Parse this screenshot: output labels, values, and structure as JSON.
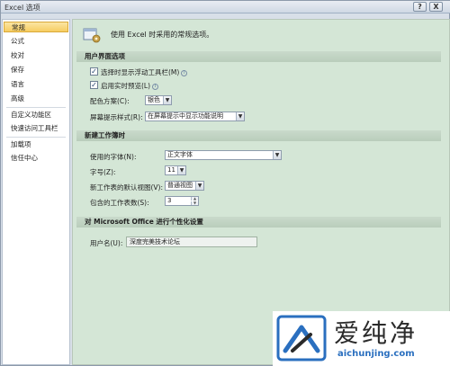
{
  "window": {
    "title": "Excel 选项",
    "help_label": "?",
    "close_label": "X"
  },
  "nav": {
    "items": [
      {
        "label": "常规",
        "selected": true
      },
      {
        "label": "公式"
      },
      {
        "label": "校对"
      },
      {
        "label": "保存"
      },
      {
        "label": "语言"
      },
      {
        "label": "高级"
      },
      {
        "label": "自定义功能区"
      },
      {
        "label": "快速访问工具栏"
      },
      {
        "label": "加载项"
      },
      {
        "label": "信任中心"
      }
    ]
  },
  "header": {
    "text": "使用 Excel 时采用的常规选项。",
    "icon": "gear-icon"
  },
  "ui_options": {
    "title": "用户界面选项",
    "show_mini_toolbar": {
      "label": "选择时显示浮动工具栏(M)",
      "checked": true
    },
    "live_preview": {
      "label": "启用实时预览(L)",
      "checked": true
    },
    "color_scheme": {
      "label": "配色方案(C):",
      "value": "银色"
    },
    "screentip_style": {
      "label": "屏幕提示样式(R):",
      "value": "在屏幕提示中显示功能说明"
    }
  },
  "new_workbook": {
    "title": "新建工作簿时",
    "font": {
      "label": "使用的字体(N):",
      "value": "正文字体"
    },
    "font_size": {
      "label": "字号(Z):",
      "value": "11"
    },
    "default_view": {
      "label": "新工作表的默认视图(V):",
      "value": "普通视图"
    },
    "sheet_count": {
      "label": "包含的工作表数(S):",
      "value": "3"
    }
  },
  "personalize": {
    "title": "对 Microsoft Office 进行个性化设置",
    "username": {
      "label": "用户名(U):",
      "value": "深度完美技术论坛"
    }
  },
  "watermark": {
    "title": "爱纯净",
    "url": "aichunjing.com"
  },
  "colors": {
    "content_bg": "#d4e6d6",
    "nav_selected": "#f7cd61",
    "brand_blue": "#2a6fbf"
  }
}
